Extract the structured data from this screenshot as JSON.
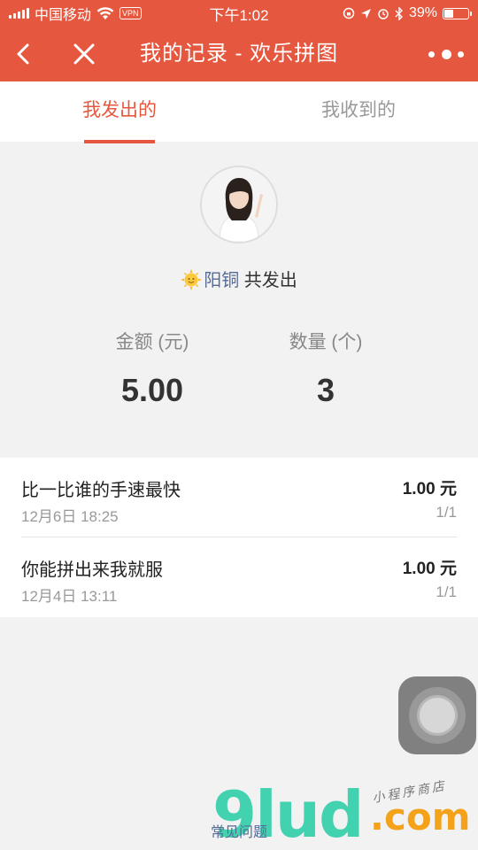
{
  "status_bar": {
    "carrier": "中国移动",
    "vpn_label": "VPN",
    "time": "下午1:02",
    "battery": "39%",
    "battery_level": 0.39
  },
  "nav": {
    "title": "我的记录 - 欢乐拼图"
  },
  "tabs": [
    {
      "label": "我发出的",
      "active": true
    },
    {
      "label": "我收到的",
      "active": false
    }
  ],
  "profile": {
    "nickname": "阳铜",
    "sent_label": "共发出"
  },
  "stats": {
    "amount_label": "金额 (元)",
    "amount_value": "5.00",
    "count_label": "数量 (个)",
    "count_value": "3"
  },
  "records": [
    {
      "title": "比一比谁的手速最快",
      "date": "12月6日 18:25",
      "amount": "1.00 元",
      "count": "1/1"
    },
    {
      "title": "你能拼出来我就服",
      "date": "12月4日 13:11",
      "amount": "1.00 元",
      "count": "1/1"
    }
  ],
  "footer": {
    "faq": "常见问题"
  },
  "watermark": {
    "brand": "9lud",
    "domain": ".com",
    "tagline": "小程序商店"
  },
  "colors": {
    "brand": "#e5573e",
    "link": "#576b95",
    "watermark_green": "#2fcfa9",
    "watermark_orange": "#f3a21a"
  },
  "icons": [
    "back-icon",
    "close-icon",
    "more-icon",
    "sun-emoji-icon",
    "wifi-icon",
    "battery-icon",
    "assistive-touch-icon"
  ]
}
